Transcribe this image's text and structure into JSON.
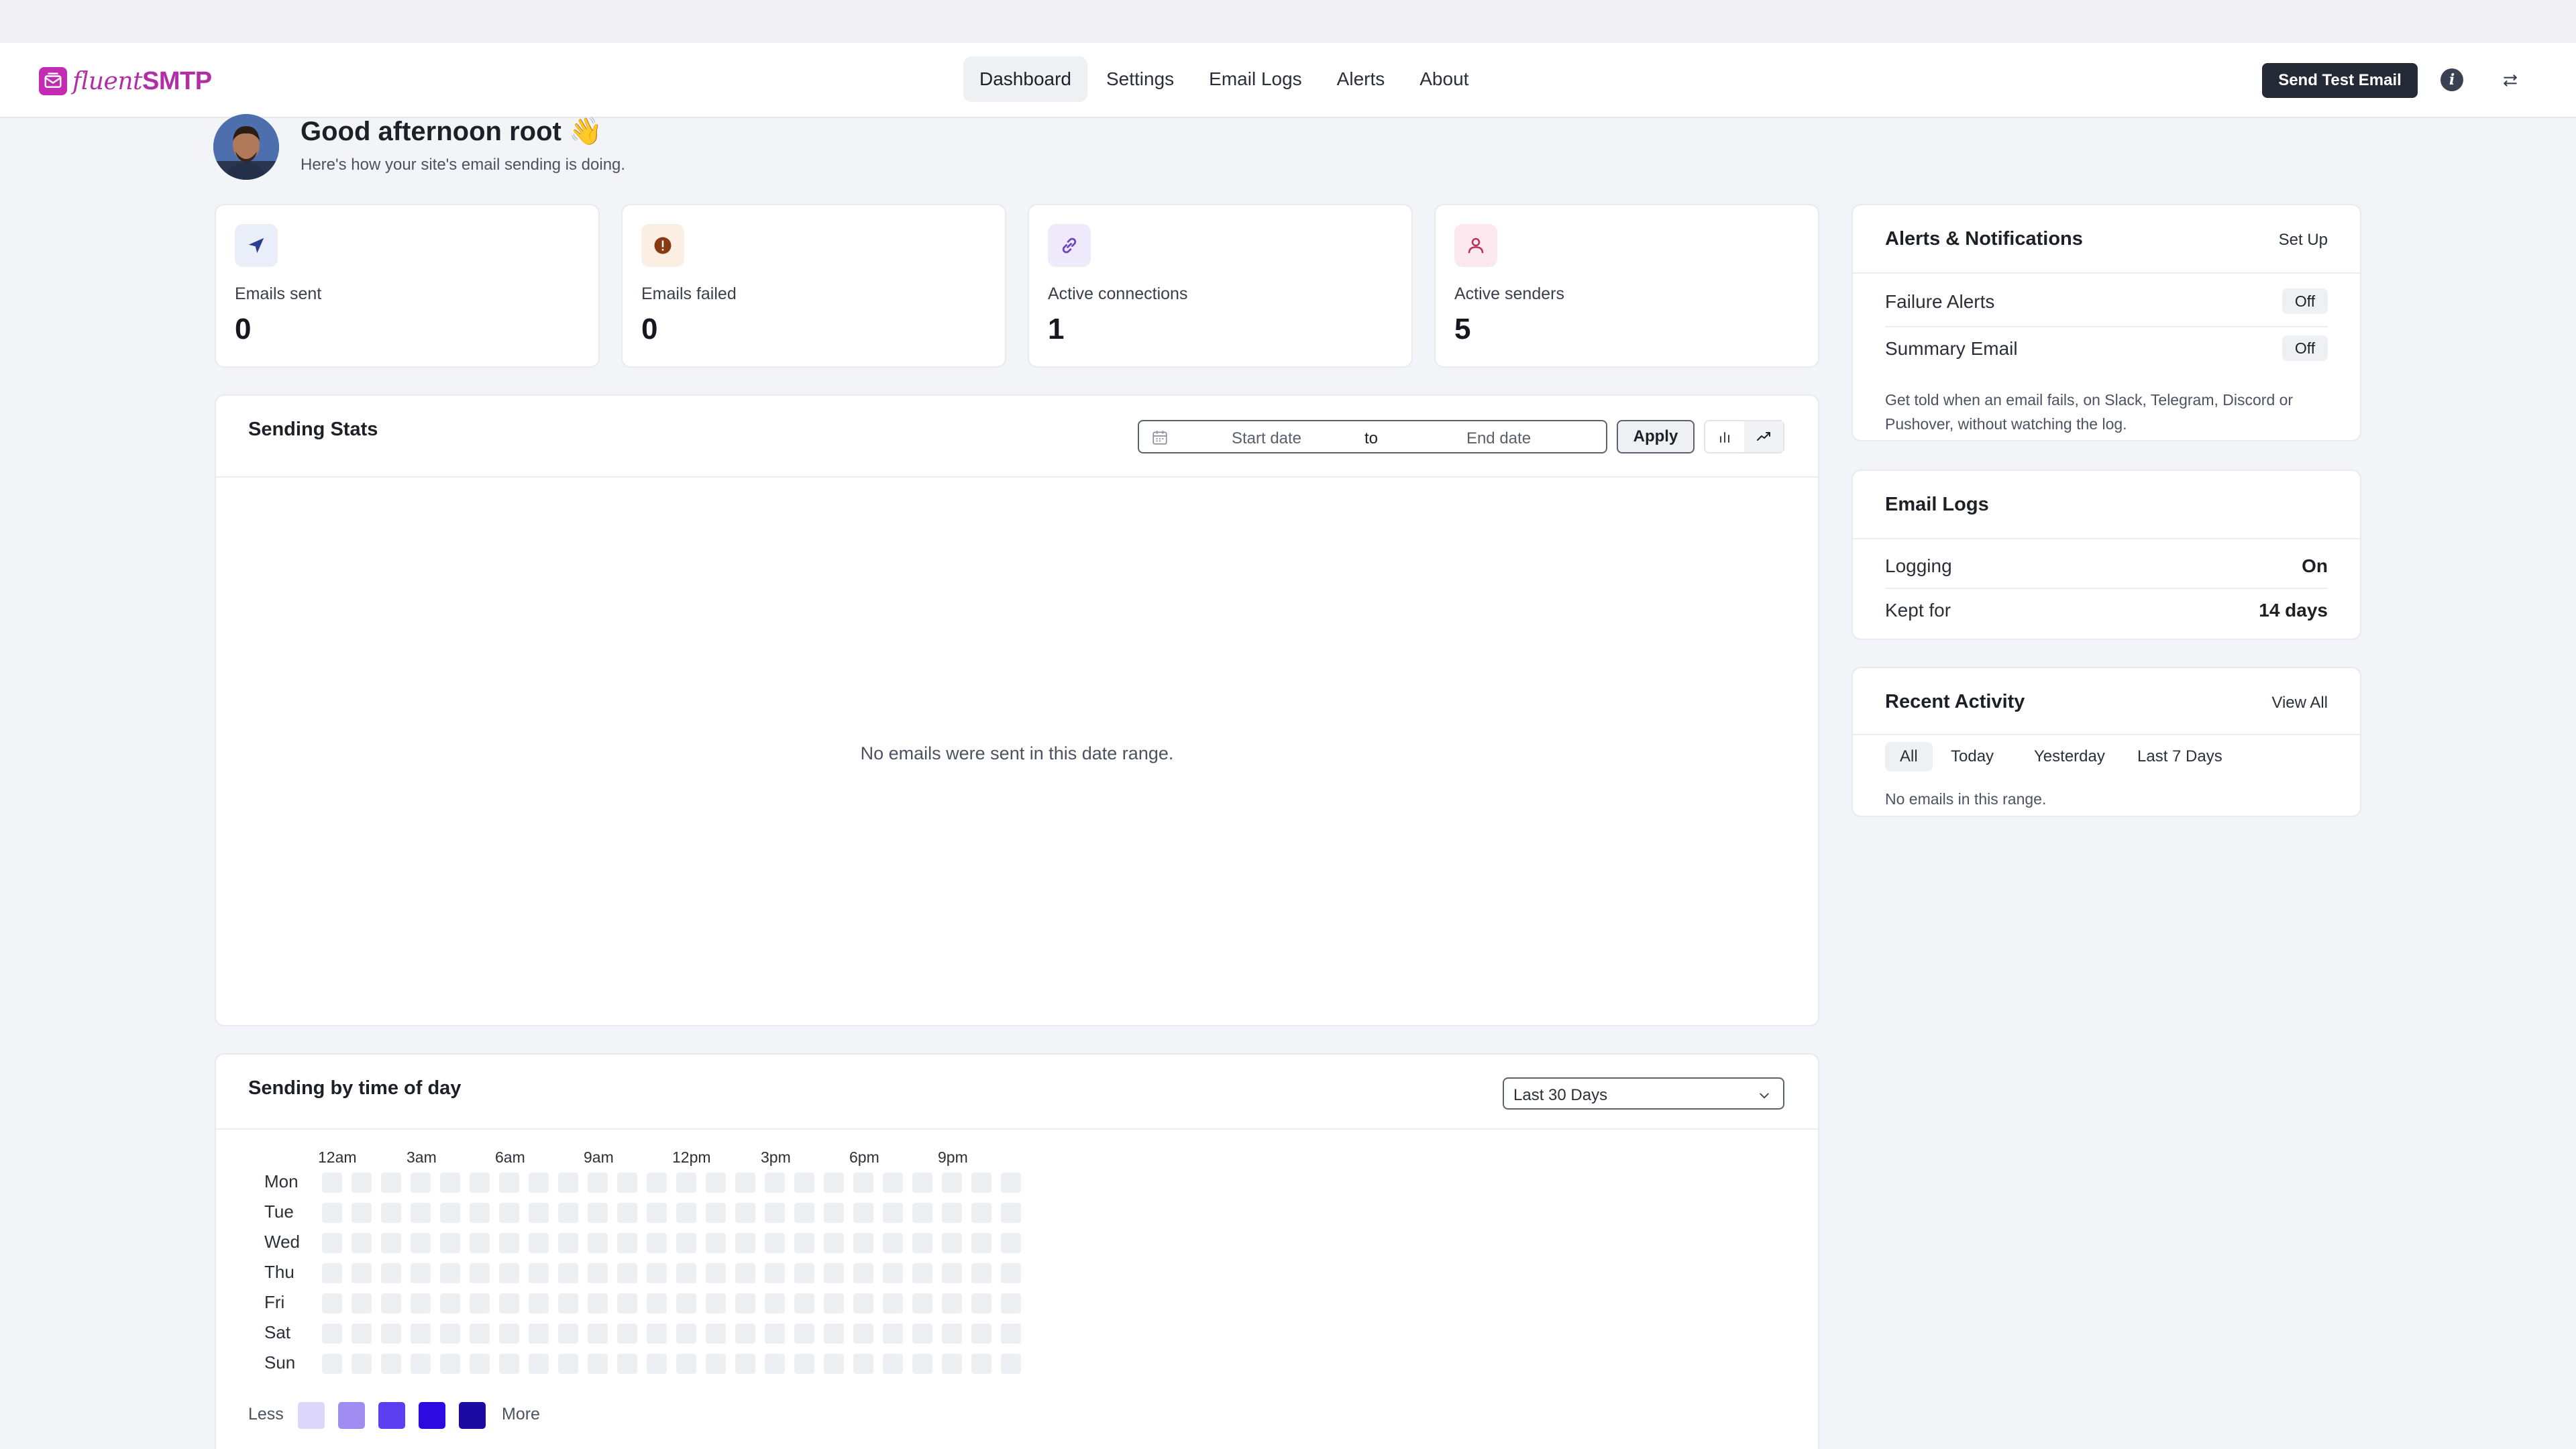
{
  "brand": {
    "name_part1": "fluent",
    "name_part2": "SMTP",
    "icon": "envelope-logo-icon",
    "color": "#b22ea7"
  },
  "nav": {
    "items": [
      {
        "label": "Dashboard",
        "active": true
      },
      {
        "label": "Settings"
      },
      {
        "label": "Email Logs"
      },
      {
        "label": "Alerts"
      },
      {
        "label": "About"
      }
    ],
    "send_test_label": "Send Test Email",
    "info_icon": "info-icon",
    "settings_icon": "sliders-icon"
  },
  "greeting": {
    "title": "Good afternoon root 👋",
    "subtitle": "Here's how your site's email sending is doing."
  },
  "stats": [
    {
      "label": "Emails sent",
      "value": "0",
      "icon": "paper-plane-icon",
      "icon_bg": "#e9eef8",
      "icon_color": "#2a3f8f"
    },
    {
      "label": "Emails failed",
      "value": "0",
      "icon": "alert-circle-icon",
      "icon_bg": "#fbeee2",
      "icon_color": "#8a3a12"
    },
    {
      "label": "Active connections",
      "value": "1",
      "icon": "link-icon",
      "icon_bg": "#efeafb",
      "icon_color": "#6b46c1"
    },
    {
      "label": "Active senders",
      "value": "5",
      "icon": "user-icon",
      "icon_bg": "#fbe9ef",
      "icon_color": "#b83260"
    }
  ],
  "sending_stats": {
    "title": "Sending Stats",
    "start_placeholder": "Start date",
    "to_label": "to",
    "end_placeholder": "End date",
    "apply_label": "Apply",
    "empty_message": "No emails were sent in this date range."
  },
  "time_of_day": {
    "title": "Sending by time of day",
    "range_value": "Last 30 Days",
    "hours": [
      "12am",
      "3am",
      "6am",
      "9am",
      "12pm",
      "3pm",
      "6pm",
      "9pm"
    ],
    "days": [
      "Mon",
      "Tue",
      "Wed",
      "Thu",
      "Fri",
      "Sat",
      "Sun"
    ],
    "legend_less": "Less",
    "legend_more": "More",
    "legend_colors": [
      "#dcd6fb",
      "#9f8df2",
      "#5b3ff0",
      "#2d0be0",
      "#1d0aa3"
    ],
    "empty_cell_color": "#eeeff2"
  },
  "alerts": {
    "title": "Alerts & Notifications",
    "setup_label": "Set Up",
    "rows": [
      {
        "label": "Failure Alerts",
        "value": "Off"
      },
      {
        "label": "Summary Email",
        "value": "Off"
      }
    ],
    "description": "Get told when an email fails, on Slack, Telegram, Discord or Pushover, without watching the log."
  },
  "email_logs": {
    "title": "Email Logs",
    "rows": [
      {
        "label": "Logging",
        "value": "On"
      },
      {
        "label": "Kept for",
        "value": "14 days"
      }
    ]
  },
  "recent_activity": {
    "title": "Recent Activity",
    "view_all_label": "View All",
    "filters": [
      {
        "label": "All",
        "active": true
      },
      {
        "label": "Today"
      },
      {
        "label": "Yesterday"
      },
      {
        "label": "Last 7 Days"
      }
    ],
    "empty_message": "No emails in this range."
  }
}
